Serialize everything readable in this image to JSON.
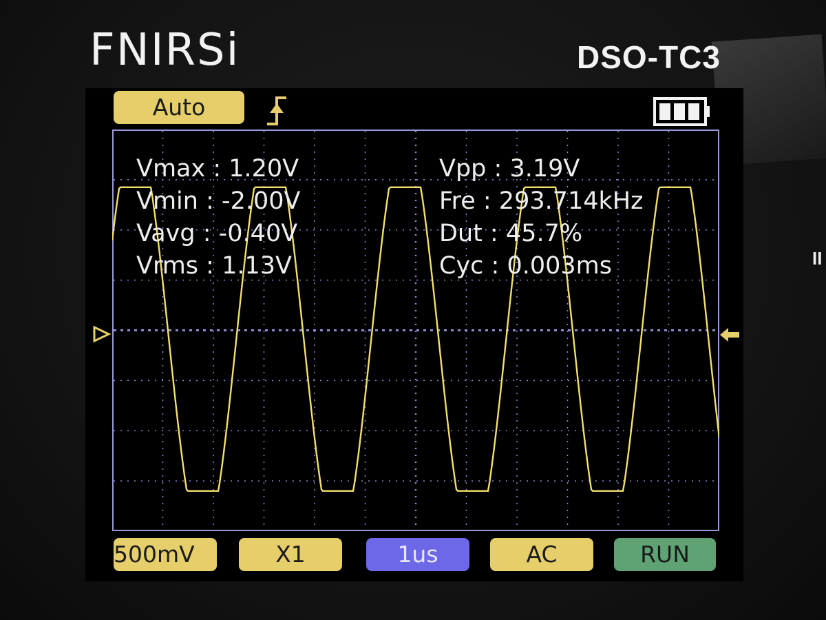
{
  "device": {
    "brand": "FNIRSi",
    "model": "DSO-TC3",
    "side_mark": "II"
  },
  "status_bar": {
    "trigger_mode": "Auto",
    "trigger_edge_icon": "rising-edge-trigger-icon",
    "battery_icon": "battery-full-icon"
  },
  "measurements": {
    "left": [
      {
        "label": "Vmax",
        "value": "1.20V"
      },
      {
        "label": "Vmin",
        "value": "-2.00V"
      },
      {
        "label": "Vavg",
        "value": "-0.40V"
      },
      {
        "label": "Vrms",
        "value": "1.13V"
      }
    ],
    "right": [
      {
        "label": "Vpp",
        "value": "3.19V"
      },
      {
        "label": "Fre",
        "value": "293.714kHz"
      },
      {
        "label": "Dut",
        "value": "45.7%"
      },
      {
        "label": "Cyc",
        "value": "0.003ms"
      }
    ]
  },
  "bottom_bar": {
    "volts_div": "500mV",
    "probe": "X1",
    "time_div": "1us",
    "coupling": "AC",
    "run_state": "RUN"
  },
  "colors": {
    "trace": "#f2e06a",
    "grid": "#8f8fd8",
    "accent_yellow": "#e6cf6a",
    "accent_blue": "#6c68e8",
    "accent_green": "#5fa375"
  },
  "waveform": {
    "visible_cycles": 4.5,
    "high_level_div": 2.85,
    "low_level_div": -3.2
  }
}
